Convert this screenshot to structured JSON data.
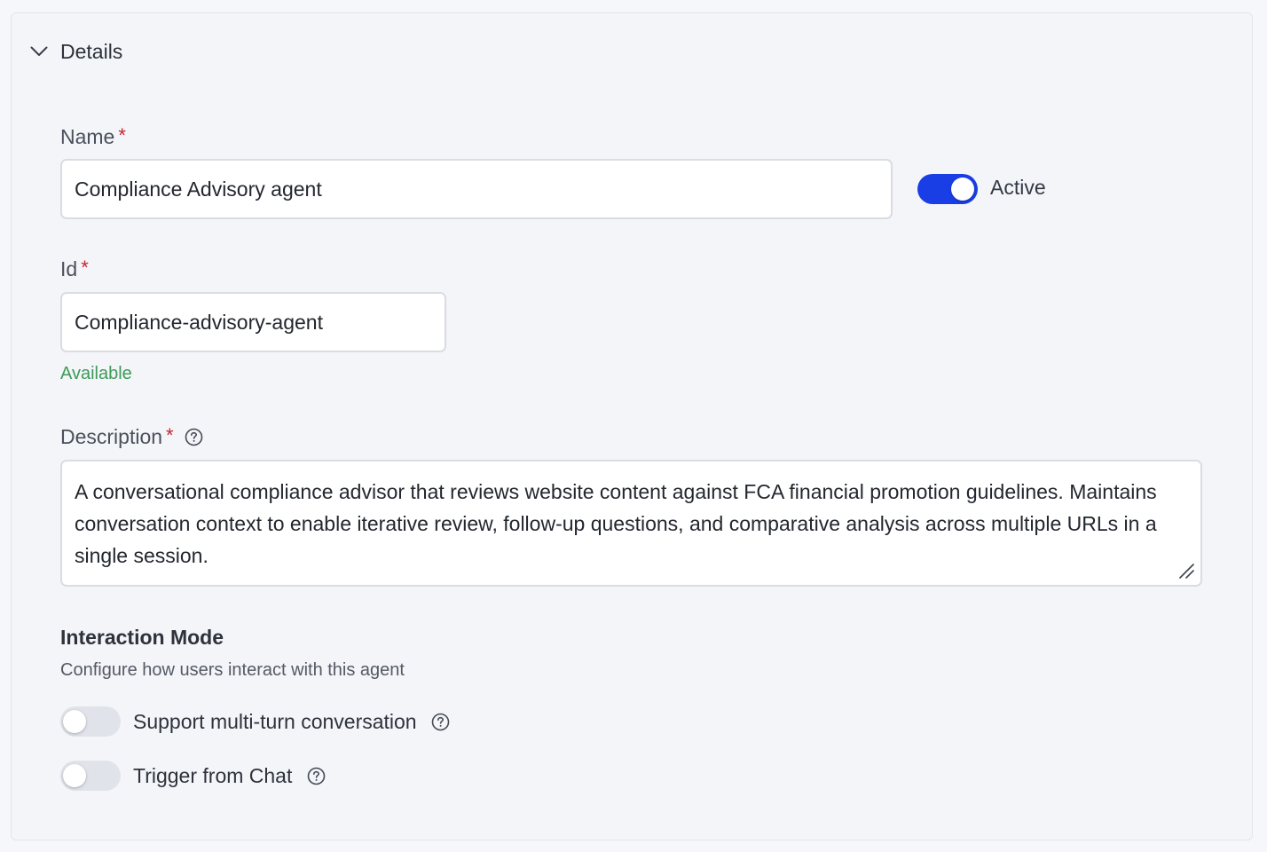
{
  "details": {
    "title": "Details",
    "chevron_icon": "chevron-down-icon"
  },
  "name_field": {
    "label": "Name",
    "required_mark": "*",
    "value": "Compliance Advisory agent"
  },
  "active_toggle": {
    "label": "Active",
    "state": "on",
    "color": "#1a3ee6"
  },
  "id_field": {
    "label": "Id",
    "required_mark": "*",
    "value": "Compliance-advisory-agent",
    "status": "Available",
    "status_color": "#3e9a58"
  },
  "description_field": {
    "label": "Description",
    "required_mark": "*",
    "help_icon": "question-circle-icon",
    "value": "A conversational compliance advisor that reviews website content against FCA financial promotion guidelines. Maintains conversation context to enable iterative review, follow-up questions, and comparative analysis across multiple URLs in a single session."
  },
  "interaction_mode": {
    "title": "Interaction Mode",
    "subtitle": "Configure how users interact with this agent",
    "options": [
      {
        "label": "Support multi-turn conversation",
        "state": "off",
        "help_icon": "question-circle-icon"
      },
      {
        "label": "Trigger from Chat",
        "state": "off",
        "help_icon": "question-circle-icon"
      }
    ]
  }
}
